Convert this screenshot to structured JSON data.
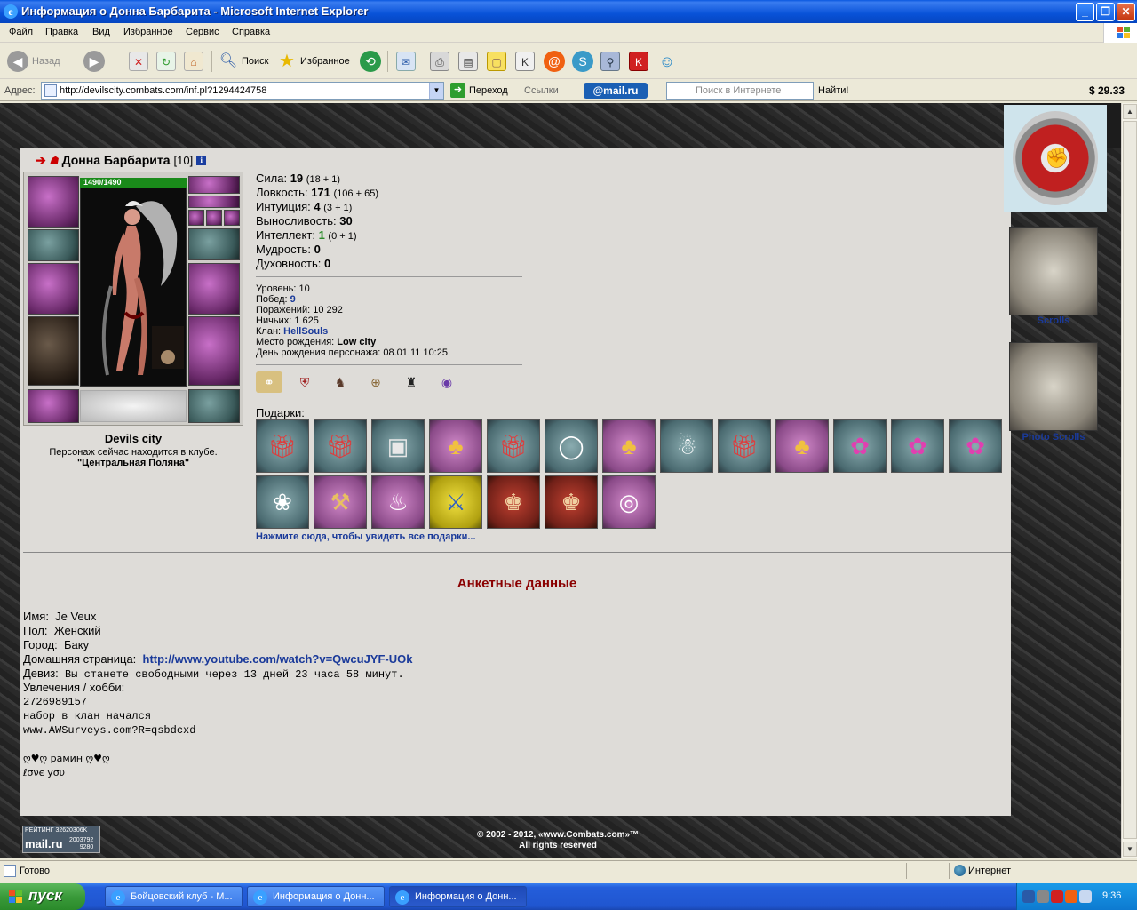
{
  "window": {
    "title": "Информация о Донна Барбарита - Microsoft Internet Explorer",
    "ie_icon": "e",
    "minimize_glyph": "_",
    "maximize_glyph": "❐",
    "close_glyph": "✕"
  },
  "menu": {
    "file": "Файл",
    "edit": "Правка",
    "view": "Вид",
    "favorites": "Избранное",
    "tools": "Сервис",
    "help": "Справка"
  },
  "toolbar": {
    "back": "Назад",
    "search": "Поиск",
    "favorites": "Избранное",
    "back_icon": "back-arrow-icon",
    "forward_icon": "forward-arrow-icon",
    "stop_icon": "stop-icon",
    "refresh_icon": "refresh-icon",
    "home_icon": "home-icon"
  },
  "address": {
    "label": "Адрес:",
    "url": "http://devilscity.combats.com/inf.pl?1294424758",
    "go": "Переход",
    "links": "Ссылки",
    "mailru": "@mail.ru",
    "search_placeholder": "Поиск в Интернете",
    "find": "Найти!",
    "money": "$ 29.33"
  },
  "character": {
    "name": "Донна Барбарита",
    "level": "[10]",
    "hp": "1490/1490",
    "city": "Devils city",
    "location_text": "Персонаж сейчас находится в клубе.",
    "location_place": "\"Центральная Поляна\""
  },
  "stats": [
    {
      "label": "Сила:",
      "value": "19",
      "sub": "(18 + 1)"
    },
    {
      "label": "Ловкость:",
      "value": "171",
      "sub": "(106 + 65)"
    },
    {
      "label": "Интуиция:",
      "value": "4",
      "sub": "(3 + 1)"
    },
    {
      "label": "Выносливость:",
      "value": "30",
      "sub": ""
    },
    {
      "label": "Интеллект:",
      "value": "1",
      "sub": "(0 + 1)"
    },
    {
      "label": "Мудрость:",
      "value": "0",
      "sub": ""
    },
    {
      "label": "Духовность:",
      "value": "0",
      "sub": ""
    }
  ],
  "info": {
    "level_label": "Уровень:",
    "level": "10",
    "wins_label": "Побед:",
    "wins": "9",
    "losses_label": "Поражений:",
    "losses": "10 292",
    "draws_label": "Ничьих:",
    "draws": "1 625",
    "clan_label": "Клан:",
    "clan": "HellSouls",
    "birthplace_label": "Место рождения:",
    "birthplace": "Low city",
    "birthday_label": "День рождения персонажа:",
    "birthday": "08.01.11 10:25"
  },
  "badges": [
    "ring-badge-icon",
    "shield-badge-icon",
    "knight-badge-icon",
    "compass-badge-icon",
    "dark-mage-badge-icon",
    "orb-badge-icon"
  ],
  "gifts_label": "Подарки:",
  "gifts": [
    {
      "icon": "gift-boxes-icon",
      "bg": "teal"
    },
    {
      "icon": "gift-boxes-icon",
      "bg": "teal"
    },
    {
      "icon": "silver-chest-icon",
      "bg": "teal"
    },
    {
      "icon": "jack-in-box-icon",
      "bg": "pink"
    },
    {
      "icon": "gift-boxes-icon",
      "bg": "teal"
    },
    {
      "icon": "pearl-necklace-icon",
      "bg": "teal"
    },
    {
      "icon": "jack-in-box-icon",
      "bg": "pink"
    },
    {
      "icon": "ghost-icon",
      "bg": "teal"
    },
    {
      "icon": "gift-boxes-icon",
      "bg": "teal"
    },
    {
      "icon": "jack-in-box-icon",
      "bg": "pink"
    },
    {
      "icon": "pink-flower-icon",
      "bg": "teal"
    },
    {
      "icon": "pink-flower-icon",
      "bg": "teal"
    },
    {
      "icon": "pink-flower-icon",
      "bg": "teal"
    },
    {
      "icon": "white-bouquet-icon",
      "bg": "teal"
    },
    {
      "icon": "golden-hammer-icon",
      "bg": "pink"
    },
    {
      "icon": "cake-icon",
      "bg": "pink"
    },
    {
      "icon": "bouquet-sword-icon",
      "bg": "yellow"
    },
    {
      "icon": "warrior-card-icon",
      "bg": "red"
    },
    {
      "icon": "warrior-card-icon",
      "bg": "red"
    },
    {
      "icon": "drum-icon",
      "bg": "pink"
    }
  ],
  "all_gifts_link": "Нажмите сюда, чтобы увидеть все подарки...",
  "anketa": {
    "title": "Анкетные данные",
    "name_label": "Имя:",
    "name": "Je Veux",
    "gender_label": "Пол:",
    "gender": "Женский",
    "city_label": "Город:",
    "city": "Баку",
    "homepage_label": "Домашняя страница:",
    "homepage": "http://www.youtube.com/watch?v=QwcuJYF-UOk",
    "motto_label": "Девиз:",
    "motto": "Вы станете свободными через 13 дней 23 часа 58 минут.",
    "hobby_label": "Увлечения / хобби:",
    "hobby_lines": [
      "2726989157",
      "набор в клан начался",
      "www.AWSurveys.com?R=qsbdcxd",
      "",
      "ღ♥ღ рамин  ღ♥ღ",
      "     ℓσνє уσυ"
    ]
  },
  "footer": {
    "copyright1": "© 2002 - 2012, «www.Combats.com»™",
    "copyright2": "All rights reserved",
    "rating1": "РЕЙТИНГ 32620306K",
    "rating_logo": "mail.ru",
    "rating2": "2003792",
    "rating3": "9280"
  },
  "sidebar": {
    "scrolls": "Scrolls",
    "photo_scrolls": "Photo Scrolls"
  },
  "status": {
    "text": "Готово",
    "zone": "Интернет"
  },
  "taskbar": {
    "start": "пуск",
    "tasks": [
      "Бойцовский клуб - M...",
      "Информация о Донн...",
      "Информация о Донн..."
    ],
    "clock": "9:36"
  }
}
